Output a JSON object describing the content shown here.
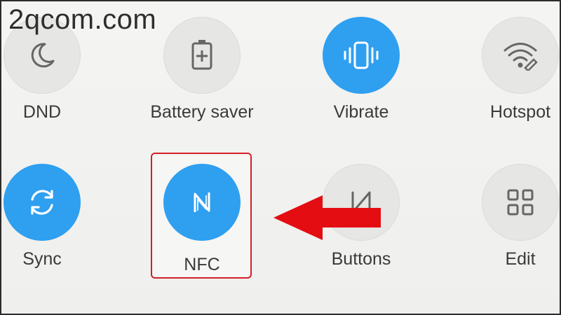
{
  "watermark": "2qcom.com",
  "tiles": [
    {
      "label": "DND",
      "icon": "moon-icon",
      "state": "off"
    },
    {
      "label": "Battery saver",
      "icon": "battery-plus-icon",
      "state": "off"
    },
    {
      "label": "Vibrate",
      "icon": "vibrate-phone-icon",
      "state": "on"
    },
    {
      "label": "Hotspot",
      "icon": "wifi-hotspot-icon",
      "state": "off"
    },
    {
      "label": "Sync",
      "icon": "sync-icon",
      "state": "on"
    },
    {
      "label": "NFC",
      "icon": "nfc-icon",
      "state": "on"
    },
    {
      "label": "Buttons",
      "icon": "buttons-icon",
      "state": "off"
    },
    {
      "label": "Edit",
      "icon": "grid-icon",
      "state": "off"
    }
  ],
  "colors": {
    "active": "#2f9ff0",
    "inactive": "#e6e6e4",
    "highlight": "#d21f27",
    "arrow": "#e30d12",
    "label": "#3a3a3a"
  }
}
